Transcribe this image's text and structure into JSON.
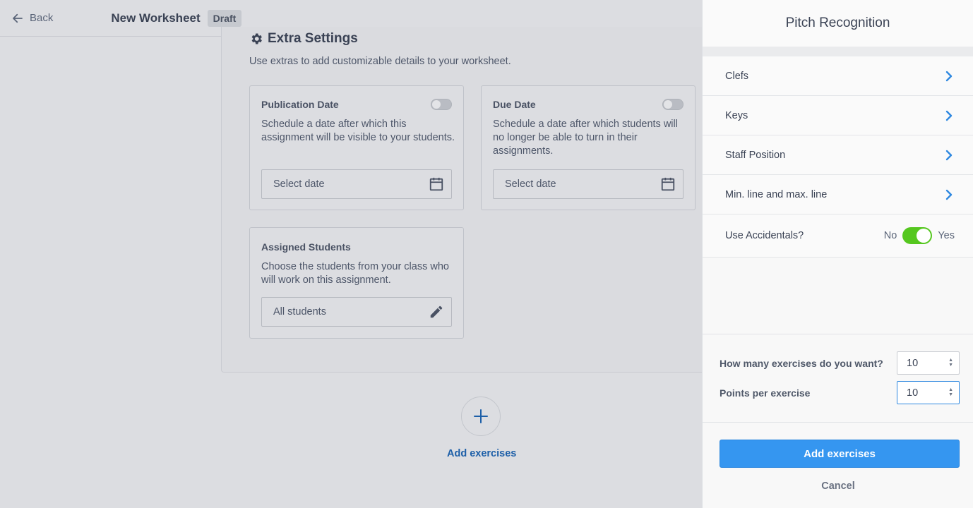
{
  "topbar": {
    "back_label": "Back",
    "title": "New Worksheet",
    "badge": "Draft"
  },
  "extra": {
    "title": "Extra Settings",
    "description": "Use extras to add customizable details to your worksheet.",
    "publication": {
      "title": "Publication Date",
      "description": "Schedule a date after which this assignment will be visible to your students.",
      "field_value": "Select date",
      "enabled": false
    },
    "due": {
      "title": "Due Date",
      "description": "Schedule a date after which students will no longer be able to turn in their assignments.",
      "field_value": "Select date",
      "enabled": false
    },
    "students": {
      "title": "Assigned Students",
      "description": "Choose the students from your class who will work on this assignment.",
      "field_value": "All students"
    }
  },
  "add": {
    "link_label": "Add exercises"
  },
  "panel": {
    "title": "Pitch Recognition",
    "rows": [
      {
        "label": "Clefs"
      },
      {
        "label": "Keys"
      },
      {
        "label": "Staff Position"
      },
      {
        "label": "Min. line and max. line"
      }
    ],
    "accidentals": {
      "label": "Use Accidentals?",
      "no_label": "No",
      "yes_label": "Yes",
      "value": true
    },
    "exercises": {
      "label": "How many exercises do you want?",
      "value": "10"
    },
    "points": {
      "label": "Points per exercise",
      "value": "10"
    },
    "primary_button": "Add exercises",
    "cancel_label": "Cancel"
  },
  "colors": {
    "accent": "#3596f0",
    "toggle_on": "#55c71f",
    "link": "#1d5fa8"
  }
}
